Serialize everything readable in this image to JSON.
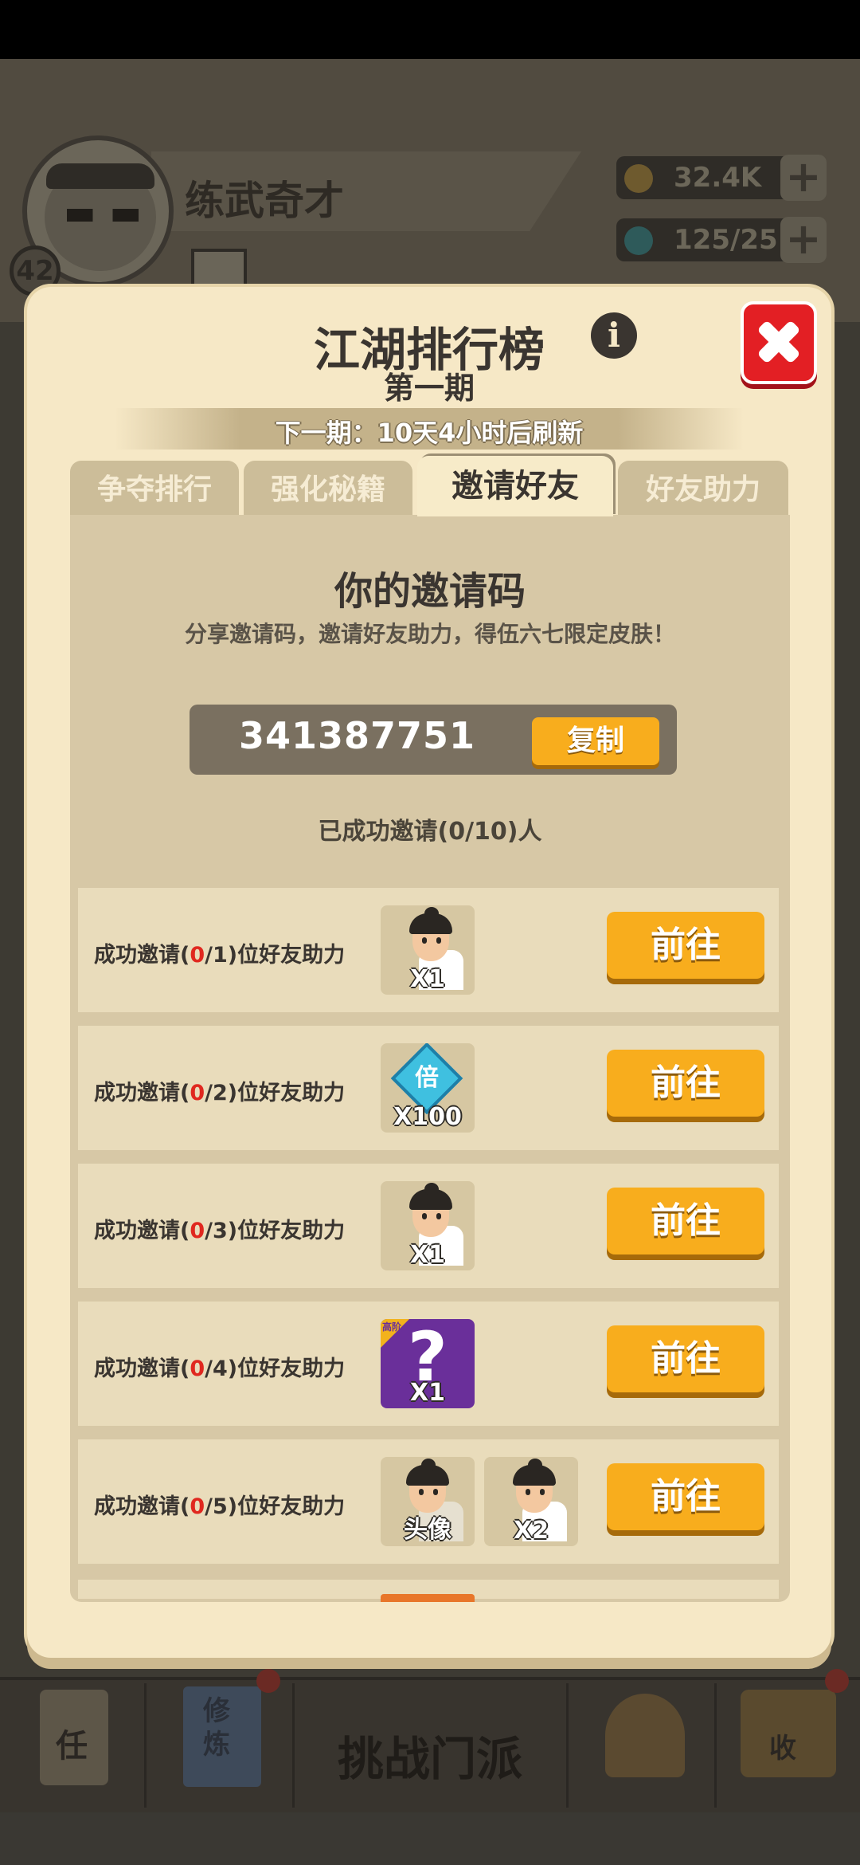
{
  "background": {
    "player_name": "练武奇才",
    "level": "42",
    "gold": "32.4K",
    "gems": "125/25",
    "bottom_nav": {
      "task_label": "任",
      "train_label": "修炼",
      "challenge_label": "挑战门派",
      "shop_label": "收"
    }
  },
  "modal": {
    "title": "江湖排行榜",
    "info_glyph": "i",
    "subtitle": "第一期",
    "next_period": "下一期：10天4小时后刷新",
    "tabs": [
      {
        "label": "争夺排行"
      },
      {
        "label": "强化秘籍"
      },
      {
        "label": "邀请好友"
      },
      {
        "label": "好友助力"
      }
    ],
    "active_tab": "邀请好友",
    "invite": {
      "heading": "你的邀请码",
      "description": "分享邀请码，邀请好友助力，得伍六七限定皮肤！",
      "code": "341387751",
      "copy_label": "复制",
      "success_count": "已成功邀请(0/10)人"
    },
    "tasks": [
      {
        "prefix": "成功邀请(",
        "progress": "0",
        "target": "/1",
        "suffix": ")位好友助力",
        "reward_1": "X1",
        "go_label": "前往"
      },
      {
        "prefix": "成功邀请(",
        "progress": "0",
        "target": "/2",
        "suffix": ")位好友助力",
        "reward_1": "X100",
        "gem_glyph": "倍",
        "go_label": "前往"
      },
      {
        "prefix": "成功邀请(",
        "progress": "0",
        "target": "/3",
        "suffix": ")位好友助力",
        "reward_1": "X1",
        "go_label": "前往"
      },
      {
        "prefix": "成功邀请(",
        "progress": "0",
        "target": "/4",
        "suffix": ")位好友助力",
        "reward_1": "X1",
        "badge": "高阶",
        "q_glyph": "?",
        "go_label": "前往"
      },
      {
        "prefix": "成功邀请(",
        "progress": "0",
        "target": "/5",
        "suffix": ")位好友助力",
        "reward_1": "头像",
        "reward_2": "X2",
        "go_label": "前往"
      }
    ]
  },
  "colors": {
    "accent_orange": "#f8ad1d",
    "close_red": "#e31f24",
    "progress_red": "#e0281f",
    "modal_bg": "#f6e8c6"
  }
}
